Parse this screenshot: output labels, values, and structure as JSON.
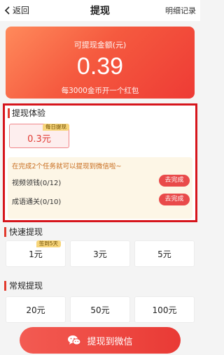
{
  "header": {
    "back_label": "返回",
    "title": "提现",
    "records_label": "明细记录"
  },
  "balance": {
    "label": "可提现金额(元)",
    "amount": "0.39",
    "note": "每3000金币开一个红包"
  },
  "experience": {
    "title": "提现体验",
    "option": {
      "value": "0.3元",
      "badge": "每日提现"
    },
    "tip": "在完成2个任务就可以提现到微信啦~",
    "tasks": [
      {
        "label": "视频领钱(0/12)",
        "action": "去完成"
      },
      {
        "label": "成语通关(0/10)",
        "action": "去完成"
      }
    ]
  },
  "quick": {
    "title": "快速提现",
    "options": [
      {
        "value": "1元",
        "badge": "签到5天"
      },
      {
        "value": "3元"
      },
      {
        "value": "5元"
      }
    ]
  },
  "regular": {
    "title": "常规提现",
    "options": [
      {
        "value": "20元"
      },
      {
        "value": "50元"
      },
      {
        "value": "100元"
      }
    ]
  },
  "withdraw_button": {
    "label": "提现到微信",
    "icon": "wechat-icon"
  },
  "colors": {
    "accent": "#e93a35",
    "highlight_border": "#d6151c",
    "badge": "#f7d57a",
    "task_bg": "#fdf6e6"
  }
}
